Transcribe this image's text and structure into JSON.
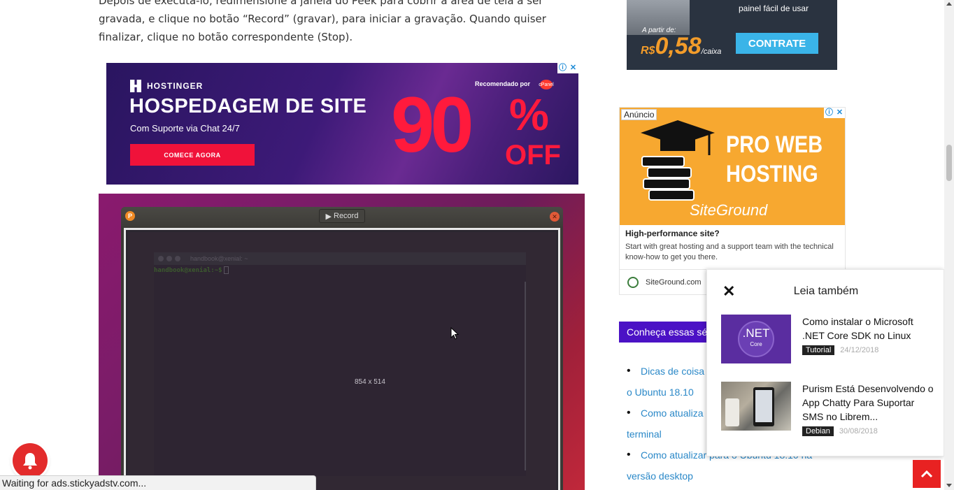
{
  "article": {
    "line1": "Depois de executá-lo, redimensione a janela do Peek para cobrir a área de tela a ser",
    "line2": "gravada, e clique no botão “Record” (gravar), para iniciar a gravação. Quando quiser",
    "line3": "finalizar, clique no botão correspondente (Stop)."
  },
  "ad_hostinger": {
    "brand": "HOSTINGER",
    "headline": "HOSPEDAGEM DE SITE",
    "subtitle": "Com Suporte via Chat 24/7",
    "cta": "COMECE AGORA",
    "recommended": "Recomendado por",
    "cpanel": "cPanel",
    "discount_number": "90",
    "discount_pct": "%",
    "discount_off": "OFF",
    "adchoices_icon": "ⓘ",
    "close_icon": "✕"
  },
  "peek": {
    "record_label": "Record",
    "terminal_title": "handbook@xenial: ~",
    "prompt": "handbook@xenial:~$",
    "dimensions": "854 x 514"
  },
  "statusbar": {
    "text": "Waiting for ads.stickyadstv.com..."
  },
  "ad_side_top": {
    "tagline_line1": "painel fácil de usar",
    "from": "A partir de:",
    "currency": "R$",
    "price": "0,58",
    "unit": "/caixa",
    "cta": "CONTRATE"
  },
  "ad_siteground": {
    "label": "Anúncio",
    "headline_line1": "PRO WEB",
    "headline_line2": "HOSTING",
    "logo_text": "SiteGround",
    "title": "High-performance site?",
    "description": "Start with great hosting and a support team with the technical know-how to get you there.",
    "domain": "SiteGround.com",
    "adchoices_icon": "ⓘ",
    "close_icon": "✕"
  },
  "sidebar_widget": {
    "title": "Conheça essas sé",
    "items": [
      {
        "text": "Dicas de coisa",
        "continuation": "o Ubuntu 18.10"
      },
      {
        "text": "Como atualiza",
        "continuation": "terminal"
      },
      {
        "text": "Como atualizar para o Ubuntu 18.10 na",
        "continuation": "versão desktop"
      }
    ]
  },
  "popup": {
    "title": "Leia também",
    "close_icon": "✕",
    "items": [
      {
        "title": "Como instalar o Microsoft .NET Core SDK no Linux",
        "tag": "Tutorial",
        "date": "24/12/2018",
        "thumb_text": ".NET",
        "thumb_sub": "Core"
      },
      {
        "title": "Purism Está Desenvolvendo o App Chatty Para Suportar SMS no Librem...",
        "tag": "Debian",
        "date": "30/08/2018"
      }
    ]
  },
  "colors": {
    "accent_red": "#e82222",
    "widget_purple": "#4b12c5",
    "link_blue": "#2a88c8"
  }
}
